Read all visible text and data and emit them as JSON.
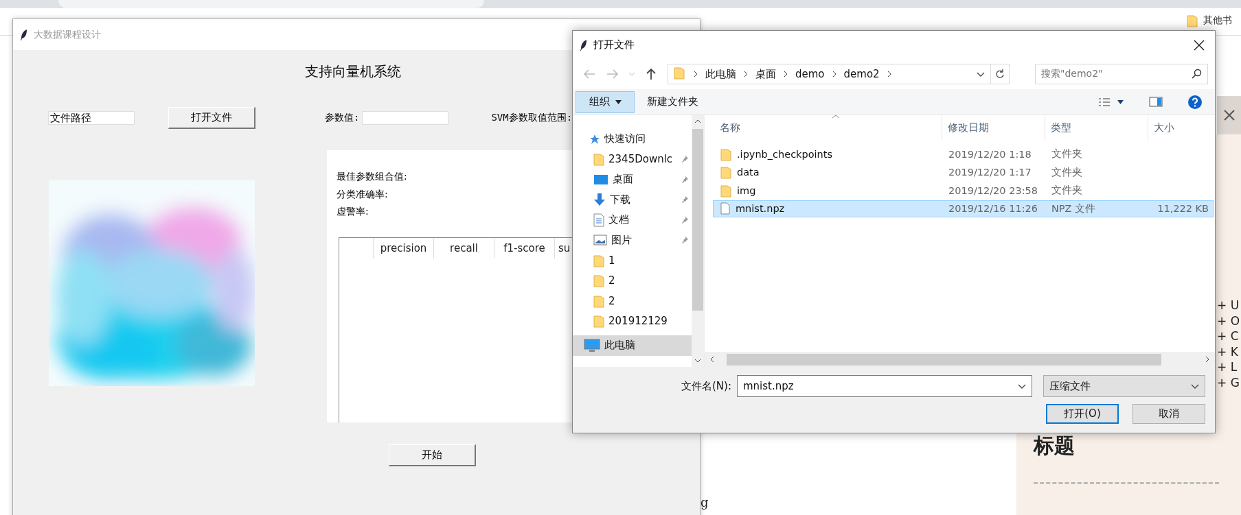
{
  "browser": {
    "bookmark": "其他书",
    "shortcuts": [
      "+ U",
      "+ O",
      "+ C",
      "+ K",
      "+ L",
      "+ G"
    ],
    "heading": "标题",
    "fragment": "g"
  },
  "app": {
    "title": "大数据课程设计",
    "active": false,
    "heading": "支持向量机系统",
    "path_field": {
      "value": "文件路径"
    },
    "open_button": "打开文件",
    "param_label": "参数值:",
    "range_label": "SVM参数取值范围:",
    "image": {
      "kind": "picture"
    },
    "results": [
      "最佳参数组合值:",
      "分类准确率:",
      "虚警率:"
    ],
    "report_table": {
      "columns": [
        "precision",
        "recall",
        "f1-score",
        "su"
      ]
    },
    "start_button": "开始"
  },
  "dialog": {
    "title": "打开文件",
    "breadcrumb": [
      "此电脑",
      "桌面",
      "demo",
      "demo2"
    ],
    "search": {
      "placeholder": "搜索\"demo2\""
    },
    "organize_button": "组织",
    "new_folder_button": "新建文件夹",
    "nav": [
      {
        "kind": "star",
        "label": "快速访问",
        "pinned": false,
        "selected": false
      },
      {
        "kind": "folder",
        "label": "2345Downlc",
        "pinned": true,
        "selected": false
      },
      {
        "kind": "desktop",
        "label": "桌面",
        "pinned": true,
        "selected": false
      },
      {
        "kind": "download",
        "label": "下载",
        "pinned": true,
        "selected": false
      },
      {
        "kind": "document",
        "label": "文档",
        "pinned": true,
        "selected": false
      },
      {
        "label": "图片",
        "pinned": true,
        "selected": false
      },
      {
        "kind": "folder",
        "label": "1",
        "pinned": false,
        "selected": false
      },
      {
        "kind": "folder",
        "label": "2",
        "pinned": false,
        "selected": false
      },
      {
        "kind": "folder",
        "label": "2",
        "pinned": false,
        "selected": false
      },
      {
        "kind": "folder",
        "label": "201912129",
        "pinned": false,
        "selected": false
      },
      {
        "kind": "computer",
        "label": "此电脑",
        "pinned": false,
        "selected": true
      }
    ],
    "columns": [
      "名称",
      "修改日期",
      "类型",
      "大小"
    ],
    "files": [
      {
        "kind": "folder",
        "name": ".ipynb_checkpoints",
        "date": "2019/12/20 1:18",
        "type": "文件夹",
        "selected": false
      },
      {
        "kind": "folder",
        "name": "data",
        "date": "2019/12/20 1:17",
        "type": "文件夹",
        "selected": false
      },
      {
        "kind": "folder",
        "name": "img",
        "date": "2019/12/20 23:58",
        "type": "文件夹",
        "selected": false
      },
      {
        "kind": "file",
        "name": "mnist.npz",
        "date": "2019/12/16 11:26",
        "type": "NPZ 文件",
        "size": "11,222 KB",
        "selected": true
      }
    ],
    "file_name": {
      "label": "文件名(N):",
      "value": "mnist.npz"
    },
    "file_type": "压缩文件",
    "buttons": [
      {
        "label": "打开(O)",
        "default": true
      },
      {
        "label": "取消",
        "default": false
      }
    ]
  }
}
